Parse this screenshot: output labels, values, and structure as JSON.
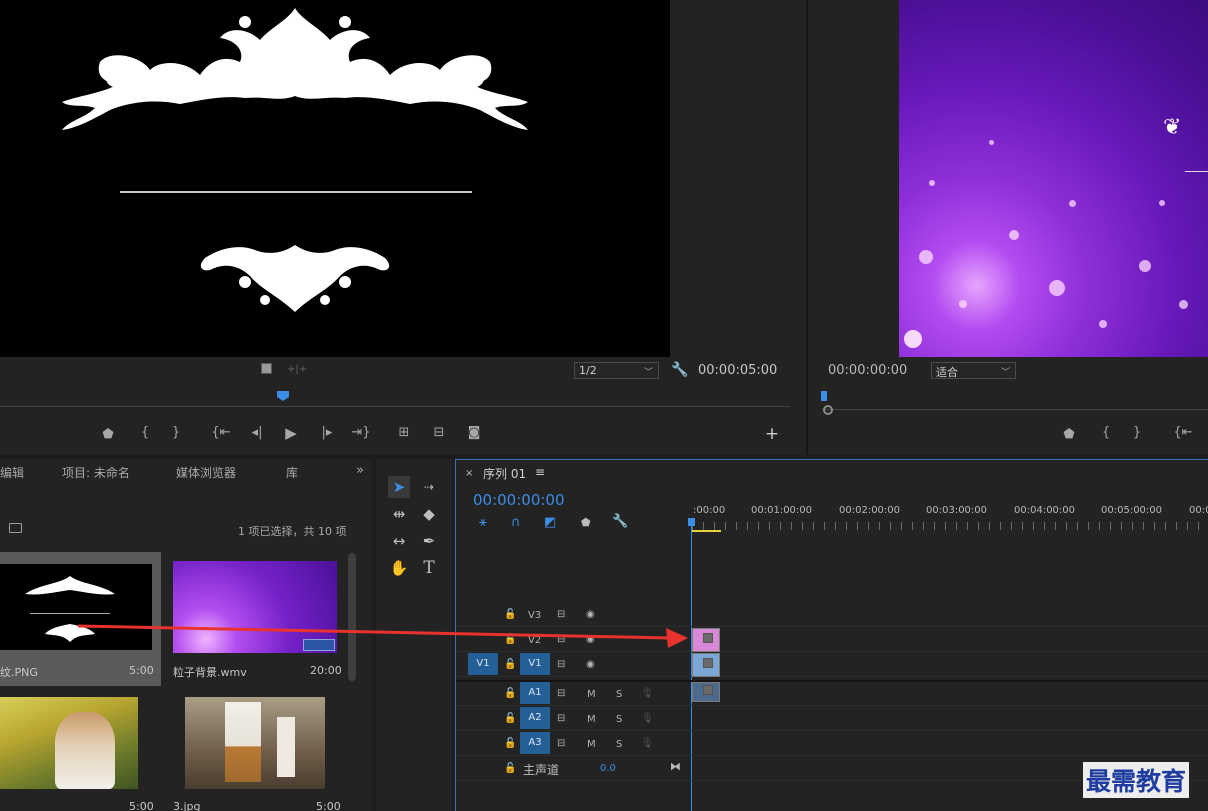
{
  "source_monitor": {
    "zoom_select": "1/2",
    "timecode": "00:00:05:00"
  },
  "program_monitor": {
    "timecode": "00:00:00:00",
    "fit_select": "适合"
  },
  "project_panel": {
    "tabs": [
      "编辑",
      "项目: 未命名",
      "媒体浏览器",
      "库"
    ],
    "selection_info": "1 项已选择，共 10 项",
    "items": [
      {
        "name": "纹.PNG",
        "duration": "5:00"
      },
      {
        "name": "粒子背景.wmv",
        "duration": "20:00"
      },
      {
        "name": "",
        "duration": "5:00"
      },
      {
        "name": "3.jpg",
        "duration": "5:00"
      }
    ]
  },
  "timeline": {
    "title": "序列 01",
    "close_glyph": "×",
    "menu_glyph": "≡",
    "timecode": "00:00:00:00",
    "ruler_labels": [
      ":00:00",
      "00:01:00:00",
      "00:02:00:00",
      "00:03:00:00",
      "00:04:00:00",
      "00:05:00:00",
      "00:0"
    ],
    "video_tracks": [
      {
        "name": "V3",
        "targeted": false,
        "source_patch": ""
      },
      {
        "name": "V2",
        "targeted": false,
        "source_patch": ""
      },
      {
        "name": "V1",
        "targeted": true,
        "source_patch": "V1"
      }
    ],
    "audio_tracks": [
      {
        "name": "A1",
        "mute": "M",
        "solo": "S"
      },
      {
        "name": "A2",
        "mute": "M",
        "solo": "S"
      },
      {
        "name": "A3",
        "mute": "M",
        "solo": "S"
      }
    ],
    "master": {
      "label": "主声道",
      "value": "0.0"
    }
  },
  "watermark": "最需教育",
  "colors": {
    "accent_blue": "#3a8ee6",
    "clip_v2": "#d789d8",
    "clip_v1": "#7aa7d6",
    "clip_a1": "#4c6a8e",
    "arrow_red": "#e8322d"
  }
}
